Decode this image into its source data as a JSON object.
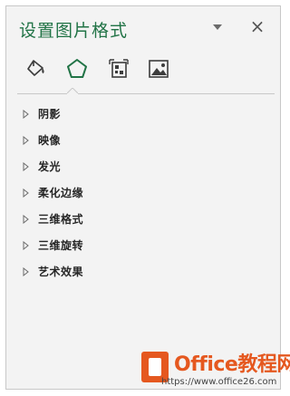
{
  "pane": {
    "title": "设置图片格式",
    "dropdown_icon": "triangle-down-icon",
    "close_label": "×"
  },
  "tabs": [
    {
      "icon": "fill-bucket-icon",
      "selected": false
    },
    {
      "icon": "pentagon-effects-icon",
      "selected": true
    },
    {
      "icon": "size-properties-icon",
      "selected": false
    },
    {
      "icon": "picture-icon",
      "selected": false
    }
  ],
  "sections": [
    {
      "label": "阴影"
    },
    {
      "label": "映像"
    },
    {
      "label": "发光"
    },
    {
      "label": "柔化边缘"
    },
    {
      "label": "三维格式"
    },
    {
      "label": "三维旋转"
    },
    {
      "label": "艺术效果"
    }
  ],
  "watermark": {
    "brand": "Office教程网",
    "url": "https://www.office26.com"
  },
  "colors": {
    "accent": "#217346",
    "pane_bg": "#f3f3f3",
    "watermark": "#e5581f"
  }
}
